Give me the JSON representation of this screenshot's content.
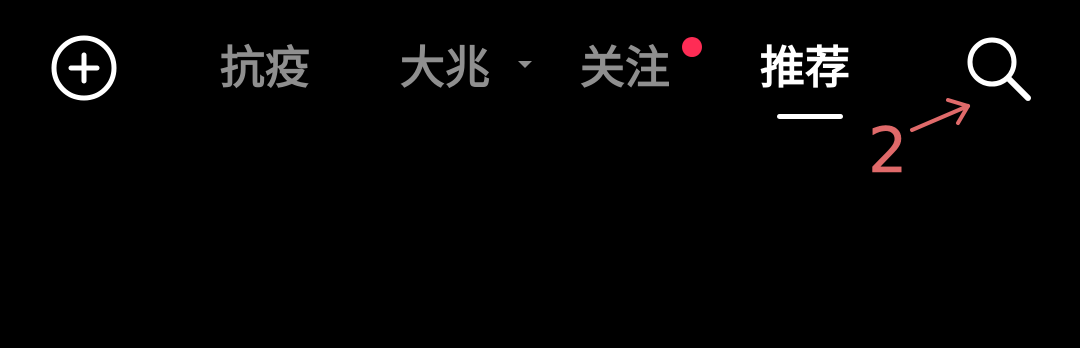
{
  "header": {
    "tabs": [
      {
        "label": "抗疫",
        "active": false
      },
      {
        "label": "大兆",
        "active": false,
        "has_dropdown": true
      },
      {
        "label": "关注",
        "active": false,
        "has_notification_dot": true
      },
      {
        "label": "推荐",
        "active": true
      }
    ],
    "add_icon": "plus-circle-icon",
    "search_icon": "search-icon"
  },
  "annotation": {
    "text": "2"
  },
  "colors": {
    "background": "#000000",
    "active_tab": "#ffffff",
    "inactive_tab": "#8f8f8f",
    "notification_dot": "#fe2c55",
    "annotation": "#e06a6a"
  }
}
